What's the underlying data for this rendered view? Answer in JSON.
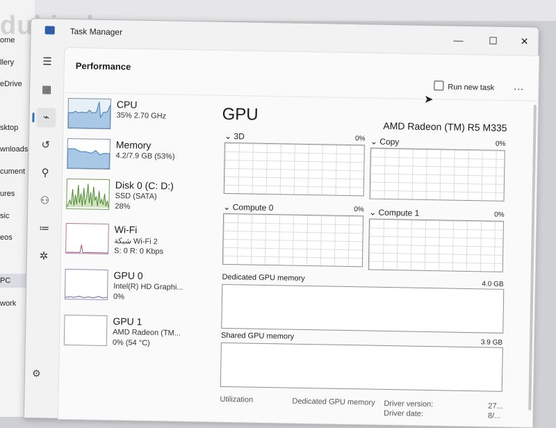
{
  "background": {
    "watermark": "dubizzle",
    "explorer_items": [
      "ome",
      "llery",
      "eDrive",
      "sktop",
      "wnloads",
      "cument",
      "ures",
      "sic",
      "eos",
      "PC",
      "work"
    ]
  },
  "window": {
    "title": "Task Manager",
    "controls": {
      "minimize": "—",
      "maximize": "☐",
      "close": "✕"
    }
  },
  "header": {
    "title": "Performance",
    "run_new_task": "Run new task",
    "more": "..."
  },
  "resources": [
    {
      "name": "CPU",
      "line1": "35%  2.70 GHz",
      "line2": ""
    },
    {
      "name": "Memory",
      "line1": "4.2/7.9 GB (53%)",
      "line2": ""
    },
    {
      "name": "Disk 0 (C: D:)",
      "line1": "SSD (SATA)",
      "line2": "28%"
    },
    {
      "name": "Wi-Fi",
      "line1": "شبكة Wi-Fi 2",
      "line2": "S: 0 R: 0 Kbps"
    },
    {
      "name": "GPU 0",
      "line1": "Intel(R) HD Graphi...",
      "line2": "0%"
    },
    {
      "name": "GPU 1",
      "line1": "AMD Radeon (TM...",
      "line2": "0%  (54 °C)"
    }
  ],
  "gpu": {
    "title": "GPU",
    "model": "AMD Radeon (TM) R5 M335",
    "engines": [
      {
        "label": "3D",
        "pct": "0%"
      },
      {
        "label": "Copy",
        "pct": "0%"
      },
      {
        "label": "Compute 0",
        "pct": "0%"
      },
      {
        "label": "Compute 1",
        "pct": "0%"
      }
    ],
    "dedicated_label": "Dedicated GPU memory",
    "dedicated_max": "4.0 GB",
    "shared_label": "Shared GPU memory",
    "shared_max": "3.9 GB",
    "stats": {
      "utilization": "Utilization",
      "dedicated": "Dedicated GPU memory",
      "driver_version": "Driver version:",
      "driver_version_val": "27...",
      "driver_date": "Driver date:",
      "driver_date_val": "8/..."
    }
  }
}
